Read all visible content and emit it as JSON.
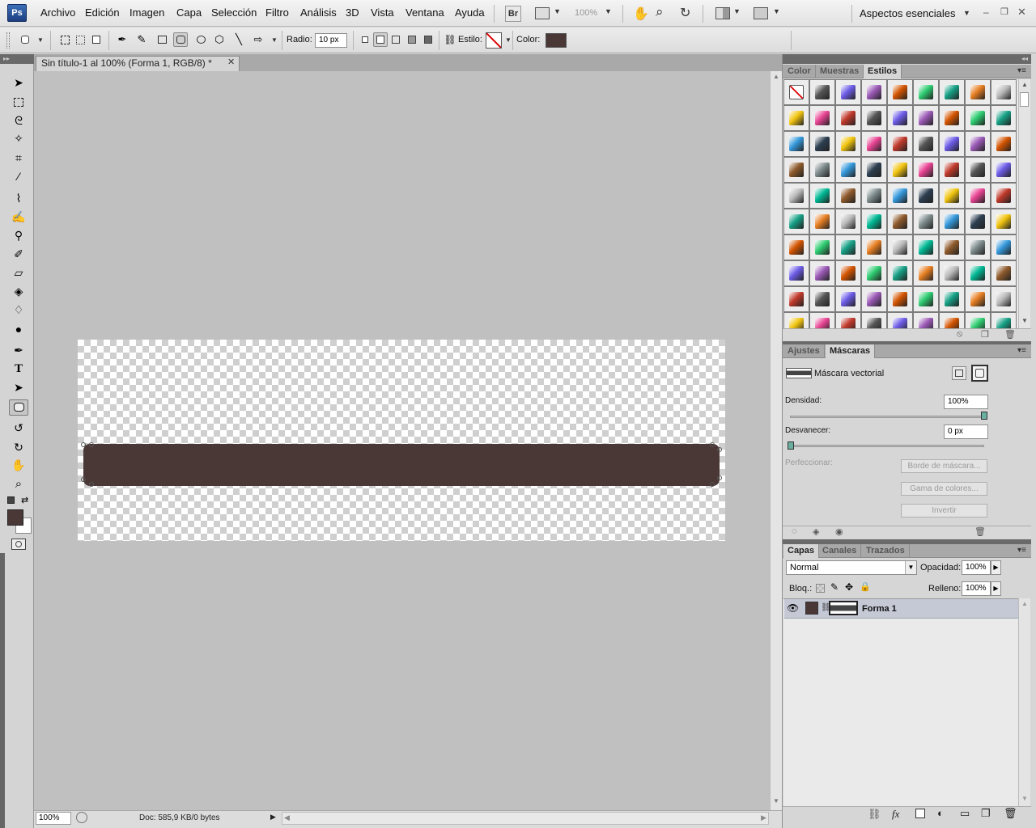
{
  "app": {
    "logo": "Ps"
  },
  "menu": {
    "items": [
      "Archivo",
      "Edición",
      "Imagen",
      "Capa",
      "Selección",
      "Filtro",
      "Análisis",
      "3D",
      "Vista",
      "Ventana",
      "Ayuda"
    ],
    "bridge": "Br",
    "zoom": "100%",
    "workspace": "Aspectos esenciales"
  },
  "options": {
    "radius_label": "Radio:",
    "radius_value": "10 px",
    "style_label": "Estilo:",
    "color_label": "Color:",
    "color_value": "#4a3837"
  },
  "document": {
    "tab_title": "Sin título-1 al 100% (Forma 1, RGB/8) *",
    "zoom": "100%",
    "doc_info": "Doc: 585,9 KB/0 bytes",
    "shape_color": "#4a3837"
  },
  "styles_panel": {
    "tabs": [
      "Color",
      "Muestras",
      "Estilos"
    ],
    "active_tab": "Estilos"
  },
  "masks_panel": {
    "tabs": [
      "Ajustes",
      "Máscaras"
    ],
    "active_tab": "Máscaras",
    "mask_type": "Máscara vectorial",
    "density_label": "Densidad:",
    "density_value": "100%",
    "feather_label": "Desvanecer:",
    "feather_value": "0 px",
    "refine_label": "Perfeccionar:",
    "btn_mask_edge": "Borde de máscara...",
    "btn_color_range": "Gama de colores...",
    "btn_invert": "Invertir"
  },
  "layers_panel": {
    "tabs": [
      "Capas",
      "Canales",
      "Trazados"
    ],
    "active_tab": "Capas",
    "blend_mode": "Normal",
    "opacity_label": "Opacidad:",
    "opacity_value": "100%",
    "lock_label": "Bloq.:",
    "fill_label": "Relleno:",
    "fill_value": "100%",
    "layers": [
      {
        "name": "Forma 1",
        "visible": true,
        "color": "#4a3837"
      }
    ]
  }
}
